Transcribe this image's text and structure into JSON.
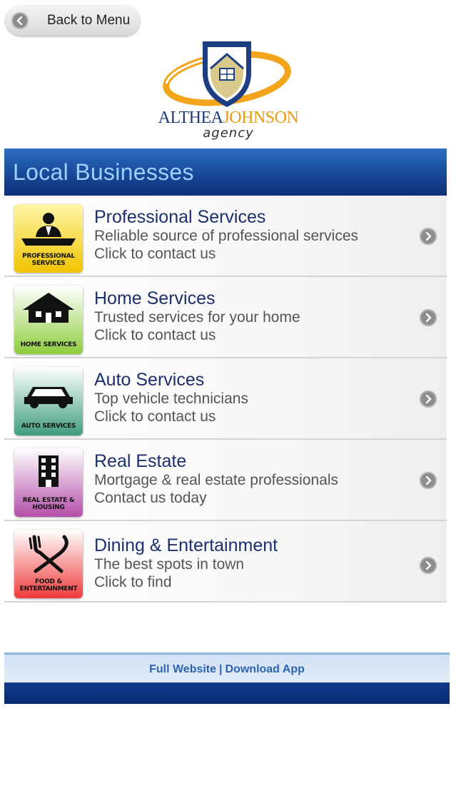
{
  "nav": {
    "back_label": "Back to Menu"
  },
  "logo": {
    "name_part1": "ALTHEA",
    "name_part2": "JOHNSON",
    "tagline": "agency"
  },
  "section": {
    "title": "Local Businesses"
  },
  "items": [
    {
      "title": "Professional Services",
      "line1": "Reliable source of professional services",
      "line2": "Click to contact us",
      "badge": "PROFESSIONAL SERVICES",
      "icon": "businessperson-icon",
      "color": "#f5d21b"
    },
    {
      "title": "Home Services",
      "line1": "Trusted services for your home",
      "line2": "Click to contact us",
      "badge": "HOME SERVICES",
      "icon": "house-icon",
      "color": "#9bd14a"
    },
    {
      "title": "Auto Services",
      "line1": "Top vehicle technicians",
      "line2": "Click to contact us",
      "badge": "AUTO SERVICES",
      "icon": "car-icon",
      "color": "#4fa88c"
    },
    {
      "title": "Real Estate",
      "line1": "Mortgage & real estate professionals",
      "line2": "Contact us today",
      "badge": "REAL ESTATE & HOUSING",
      "icon": "building-icon",
      "color": "#c060b4"
    },
    {
      "title": "Dining & Entertainment",
      "line1": "The best spots in town",
      "line2": "Click to find",
      "badge": "FOOD & ENTERTAINMENT",
      "icon": "fork-knife-icon",
      "color": "#f04848"
    }
  ],
  "footer": {
    "full_website": "Full Website",
    "separator": "|",
    "download_app": "Download App"
  }
}
